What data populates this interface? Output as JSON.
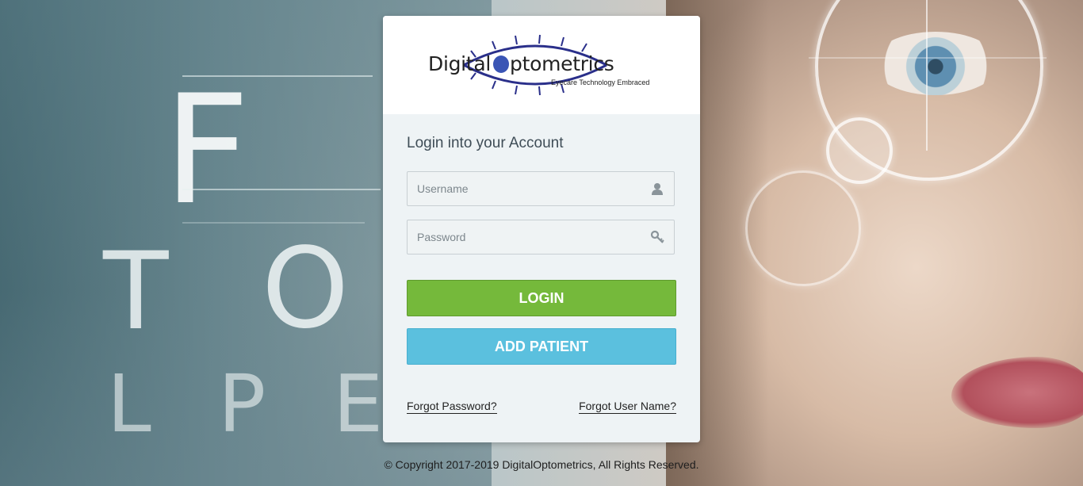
{
  "brand": {
    "name_left": "Digital",
    "name_right": "ptometrics",
    "tagline": "Eyecare Technology Embraced"
  },
  "login": {
    "title": "Login into your Account",
    "username_placeholder": "Username",
    "password_placeholder": "Password",
    "login_label": "LOGIN",
    "add_patient_label": "ADD PATIENT",
    "forgot_password_label": "Forgot Password?",
    "forgot_username_label": "Forgot User Name?"
  },
  "footer": {
    "copyright": "© Copyright 2017-2019 DigitalOptometrics, All Rights Reserved."
  },
  "background": {
    "chart_letters": [
      "F",
      "T",
      "O",
      "L",
      "P",
      "E"
    ]
  },
  "icons": {
    "username": "user-icon",
    "password": "key-icon"
  },
  "colors": {
    "login_button": "#75b93b",
    "add_patient_button": "#5bc0de",
    "logo_accent": "#3a55b5"
  }
}
